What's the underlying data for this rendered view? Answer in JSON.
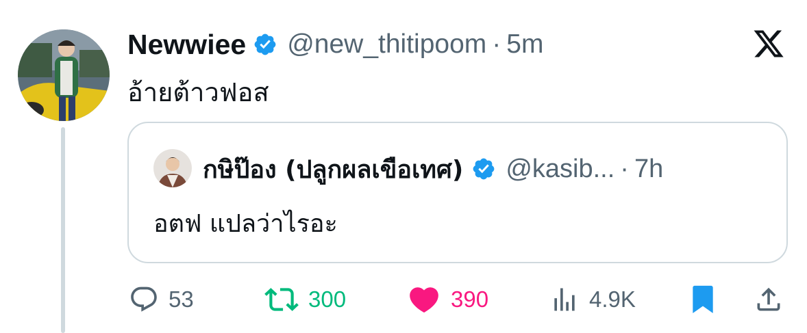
{
  "author": {
    "display_name": "Newwiee",
    "handle": "@new_thitipoom",
    "separator": "·",
    "time": "5m",
    "verified": true
  },
  "tweet": {
    "text": "อ้ายต้าวฟอส"
  },
  "quoted_tweet": {
    "display_name": "กษิป๊อง (ปลูกผลเขือเทศ)",
    "handle": "@kasib...",
    "separator": "·",
    "time": "7h",
    "verified": true,
    "text": "อตฟ แปลว่าไรอะ"
  },
  "actions": {
    "reply": {
      "icon": "reply-icon",
      "count": "53"
    },
    "retweet": {
      "icon": "retweet-icon",
      "count": "300",
      "active_color": "#00ba7c"
    },
    "like": {
      "icon": "heart-icon",
      "count": "390",
      "active_color": "#f91880"
    },
    "views": {
      "icon": "views-icon",
      "count": "4.9K"
    },
    "bookmark": {
      "icon": "bookmark-icon",
      "active_color": "#1d9bf0"
    },
    "share": {
      "icon": "share-icon"
    }
  },
  "brand": {
    "logo": "x-logo-icon"
  },
  "colors": {
    "text": "#0f1419",
    "secondary": "#536471",
    "border": "#cfd9de",
    "verified": "#1d9bf0"
  }
}
